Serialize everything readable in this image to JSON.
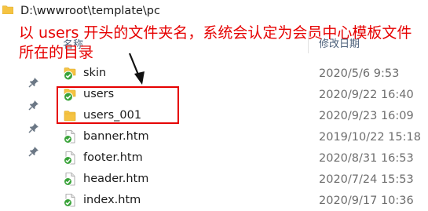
{
  "pathbar": {
    "path": "D:\\wwwroot\\template\\pc",
    "icon": "folder-icon"
  },
  "header": {
    "name_label": "名称",
    "sort_indicator": "^",
    "date_label": "修改日期"
  },
  "left_pins": [
    {
      "icon": "pin-icon"
    },
    {
      "icon": "pin-icon"
    },
    {
      "icon": "pin-icon"
    },
    {
      "icon": "pin-icon"
    }
  ],
  "rows": [
    {
      "name": "skin",
      "date": "2020/5/6 9:53",
      "icon": "folder-synced-icon"
    },
    {
      "name": "users",
      "date": "2020/9/22 16:40",
      "icon": "folder-synced-icon"
    },
    {
      "name": "users_001",
      "date": "2020/9/23 16:09",
      "icon": "folder-icon"
    },
    {
      "name": "banner.htm",
      "date": "2019/10/22 15:18",
      "icon": "file-synced-icon"
    },
    {
      "name": "footer.htm",
      "date": "2020/8/31 16:53",
      "icon": "file-synced-icon"
    },
    {
      "name": "header.htm",
      "date": "2020/7/24 15:53",
      "icon": "file-synced-icon"
    },
    {
      "name": "index.htm",
      "date": "2020/9/17 10:36",
      "icon": "file-synced-icon"
    }
  ],
  "annotation": {
    "text": "以 users 开头的文件夹名，系统会认定为会员中心模板文件所在的目录",
    "color": "#e60000"
  },
  "colors": {
    "folder": "#f5c342",
    "sync_check": "#3aa33a",
    "accent_red": "#e60000"
  }
}
